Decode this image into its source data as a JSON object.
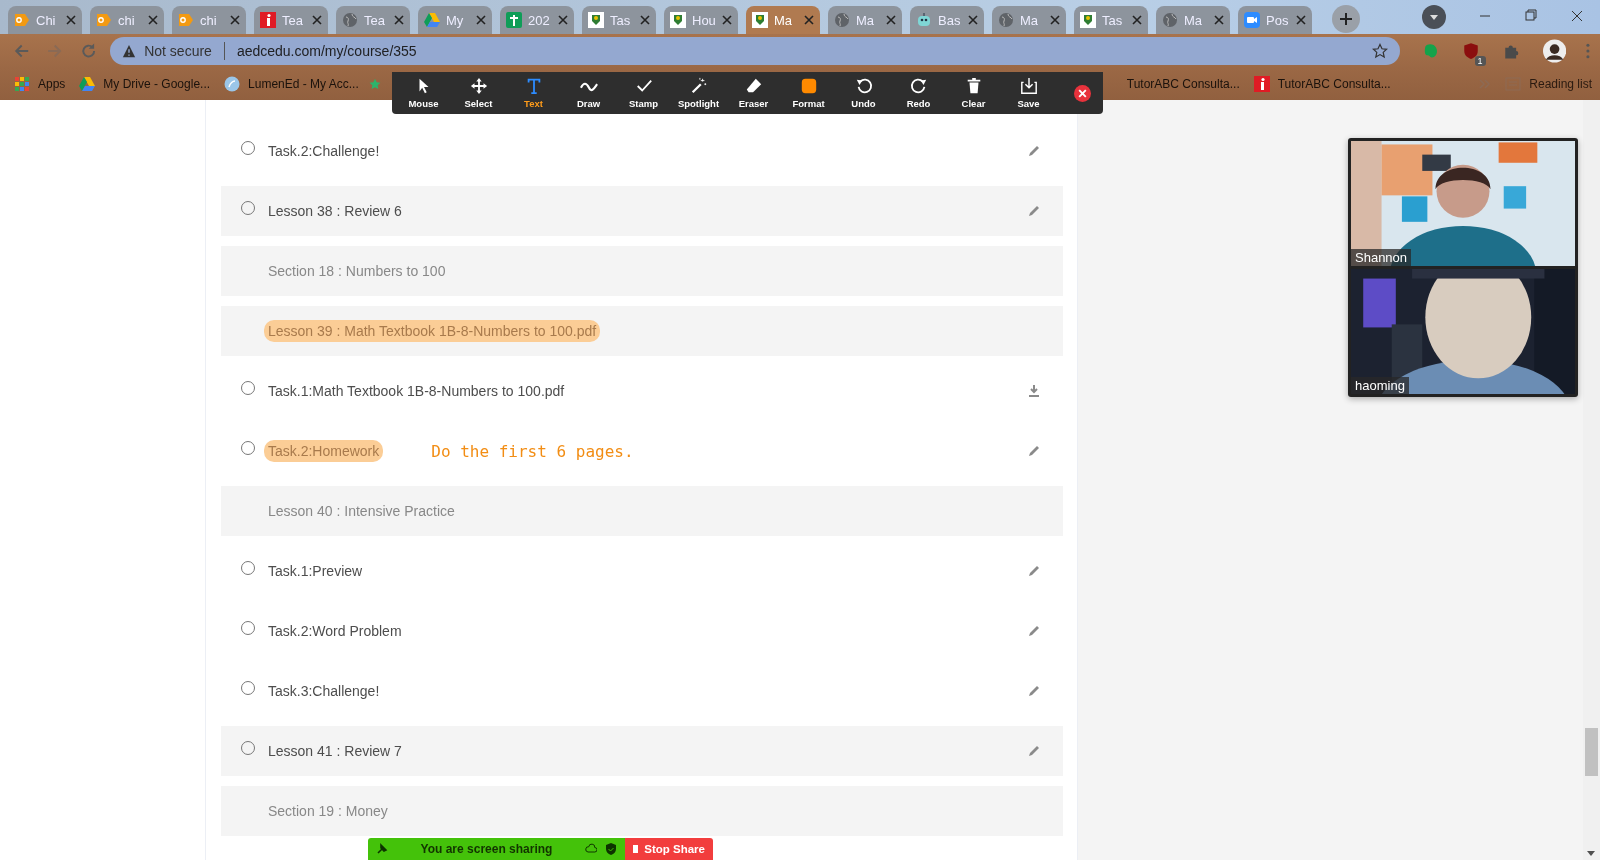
{
  "browser": {
    "tabs": [
      {
        "title": "Chi",
        "kind": "os",
        "selected": false
      },
      {
        "title": "chi",
        "kind": "os",
        "selected": false
      },
      {
        "title": "chi",
        "kind": "os",
        "selected": false
      },
      {
        "title": "Tea",
        "kind": "info",
        "selected": false
      },
      {
        "title": "Tea",
        "kind": "globe",
        "selected": false
      },
      {
        "title": "My",
        "kind": "drive",
        "selected": false
      },
      {
        "title": "202",
        "kind": "sheet",
        "selected": false
      },
      {
        "title": "Tas",
        "kind": "school",
        "selected": false
      },
      {
        "title": "Hou",
        "kind": "school",
        "selected": false
      },
      {
        "title": "Ma",
        "kind": "school",
        "selected": true
      },
      {
        "title": "Ma",
        "kind": "globe",
        "selected": false
      },
      {
        "title": "Bas",
        "kind": "bot",
        "selected": false
      },
      {
        "title": "Ma",
        "kind": "globe",
        "selected": false
      },
      {
        "title": "Tas",
        "kind": "school",
        "selected": false
      },
      {
        "title": "Ma",
        "kind": "globe",
        "selected": false
      },
      {
        "title": "Pos",
        "kind": "zoom",
        "selected": false
      }
    ],
    "security": "Not secure",
    "url": "aedcedu.com/my/course/355",
    "extension_badge": "1",
    "bookmarks": [
      {
        "title": "Apps",
        "kind": "apps"
      },
      {
        "title": "My Drive - Google...",
        "kind": "drive"
      },
      {
        "title": "LumenEd - My Acc...",
        "kind": "lumen"
      }
    ],
    "bookmarks_right": [
      {
        "title": "TutorABC Consulta...",
        "kind": "plain"
      },
      {
        "title": "TutorABC Consulta...",
        "kind": "info"
      }
    ],
    "reading_list": "Reading list"
  },
  "annotation_toolbar": [
    {
      "label": "Mouse",
      "kind": "mouse",
      "selected": false
    },
    {
      "label": "Select",
      "kind": "select",
      "selected": false
    },
    {
      "label": "Text",
      "kind": "text",
      "selected": true
    },
    {
      "label": "Draw",
      "kind": "draw",
      "selected": false
    },
    {
      "label": "Stamp",
      "kind": "stamp",
      "selected": false
    },
    {
      "label": "Spotlight",
      "kind": "spotlight",
      "selected": false
    },
    {
      "label": "Eraser",
      "kind": "eraser",
      "selected": false
    },
    {
      "label": "Format",
      "kind": "format",
      "selected": false
    },
    {
      "label": "Undo",
      "kind": "undo",
      "selected": false
    },
    {
      "label": "Redo",
      "kind": "redo",
      "selected": false
    },
    {
      "label": "Clear",
      "kind": "clear",
      "selected": false
    },
    {
      "label": "Save",
      "kind": "save",
      "selected": false
    }
  ],
  "course_items": [
    {
      "kind": "task",
      "text": "Task.2:Challenge!",
      "checked": false,
      "highlighted": false
    },
    {
      "kind": "lesson",
      "text": "Lesson 38 : Review 6",
      "checked": false,
      "highlighted": false
    },
    {
      "kind": "heading",
      "text": "Section 18 : Numbers to 100",
      "highlighted": false
    },
    {
      "kind": "heading",
      "text": "Lesson 39 : Math Textbook 1B-8-Numbers to 100.pdf",
      "highlighted": true
    },
    {
      "kind": "file",
      "text": "Task.1:Math Textbook 1B-8-Numbers to 100.pdf",
      "checked": false,
      "highlighted": false
    },
    {
      "kind": "task",
      "text": "Task.2:Homework",
      "checked": false,
      "highlighted": true,
      "note": "Do the first 6 pages."
    },
    {
      "kind": "heading",
      "text": "Lesson 40 : Intensive Practice",
      "highlighted": false
    },
    {
      "kind": "task",
      "text": "Task.1:Preview",
      "checked": false,
      "highlighted": false
    },
    {
      "kind": "task",
      "text": "Task.2:Word Problem",
      "checked": false,
      "highlighted": false
    },
    {
      "kind": "task",
      "text": "Task.3:Challenge!",
      "checked": false,
      "highlighted": false
    },
    {
      "kind": "lesson",
      "text": "Lesson 41 : Review 7",
      "checked": false,
      "highlighted": false
    },
    {
      "kind": "heading",
      "text": "Section 19 : Money",
      "highlighted": false
    }
  ],
  "video_participants": [
    {
      "name": "Shannon",
      "kind": "bright"
    },
    {
      "name": "haoming",
      "kind": "dark"
    }
  ],
  "share_bar": {
    "status": "You are screen sharing",
    "stop_button": "Stop Share"
  }
}
